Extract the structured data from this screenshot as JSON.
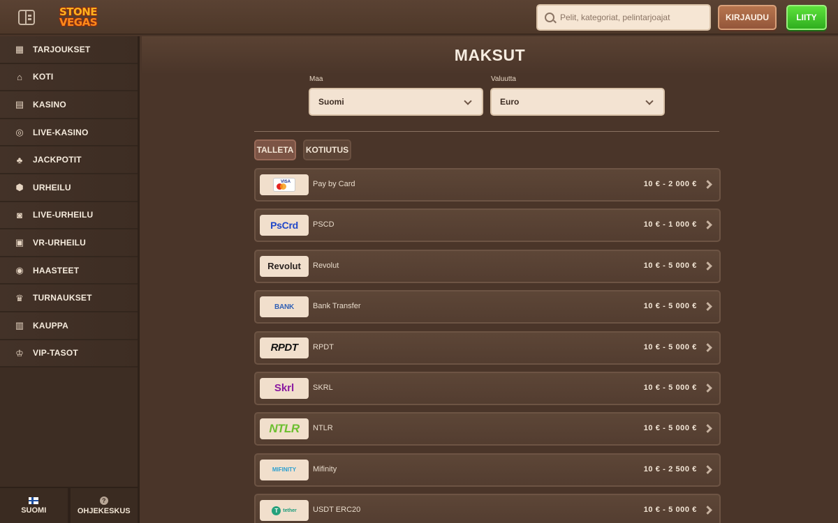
{
  "header": {
    "logo_line1": "STONE",
    "logo_line2": "VEGAS",
    "search_placeholder": "Pelit, kategoriat, pelintarjoajat",
    "login_label": "KIRJAUDU",
    "join_label": "LIITY"
  },
  "sidebar": {
    "items": [
      {
        "label": "TARJOUKSET",
        "icon": "gift-icon"
      },
      {
        "label": "KOTI",
        "icon": "home-icon"
      },
      {
        "label": "KASINO",
        "icon": "slot-machine-icon"
      },
      {
        "label": "LIVE-KASINO",
        "icon": "roulette-icon"
      },
      {
        "label": "JACKPOTIT",
        "icon": "clover-icon"
      },
      {
        "label": "URHEILU",
        "icon": "soccer-ball-icon"
      },
      {
        "label": "LIVE-URHEILU",
        "icon": "live-sport-icon"
      },
      {
        "label": "VR-URHEILU",
        "icon": "vr-sport-icon"
      },
      {
        "label": "HAASTEET",
        "icon": "target-icon"
      },
      {
        "label": "TURNAUKSET",
        "icon": "trophy-icon"
      },
      {
        "label": "KAUPPA",
        "icon": "shop-icon"
      },
      {
        "label": "VIP-TASOT",
        "icon": "crown-icon"
      }
    ],
    "footer": {
      "language_label": "SUOMI",
      "help_label": "OHJEKESKUS"
    }
  },
  "main": {
    "title": "MAKSUT",
    "country_label": "Maa",
    "country_value": "Suomi",
    "currency_label": "Valuutta",
    "currency_value": "Euro",
    "tabs": [
      {
        "label": "TALLETA",
        "active": true
      },
      {
        "label": "KOTIUTUS",
        "active": false
      }
    ],
    "methods": [
      {
        "name": "Pay by Card",
        "range": "10 € - 2 000 €",
        "logo": "visa"
      },
      {
        "name": "PSCD",
        "range": "10 € - 1 000 €",
        "logo": "pscrd",
        "logo_text": "PsCrd"
      },
      {
        "name": "Revolut",
        "range": "10 € - 5 000 €",
        "logo": "revolut",
        "logo_text": "Revolut"
      },
      {
        "name": "Bank Transfer",
        "range": "10 € - 5 000 €",
        "logo": "bank",
        "logo_text": "BANK"
      },
      {
        "name": "RPDT",
        "range": "10 € - 5 000 €",
        "logo": "rpdt",
        "logo_text": "RPDT"
      },
      {
        "name": "SKRL",
        "range": "10 € - 5 000 €",
        "logo": "skrl",
        "logo_text": "Skrl"
      },
      {
        "name": "NTLR",
        "range": "10 € - 5 000 €",
        "logo": "ntlr",
        "logo_text": "NTLR"
      },
      {
        "name": "Mifinity",
        "range": "10 € - 2 500 €",
        "logo": "mifinity",
        "logo_text": "MIFINITY"
      },
      {
        "name": "USDT ERC20",
        "range": "10 € - 5 000 €",
        "logo": "tether",
        "logo_text": "tether"
      }
    ]
  },
  "colors": {
    "background": "#4a3529",
    "sidebar": "#3d2d23",
    "login_button": "#93563a",
    "join_button": "#2fae1f",
    "active_tab": "#7c5445"
  }
}
